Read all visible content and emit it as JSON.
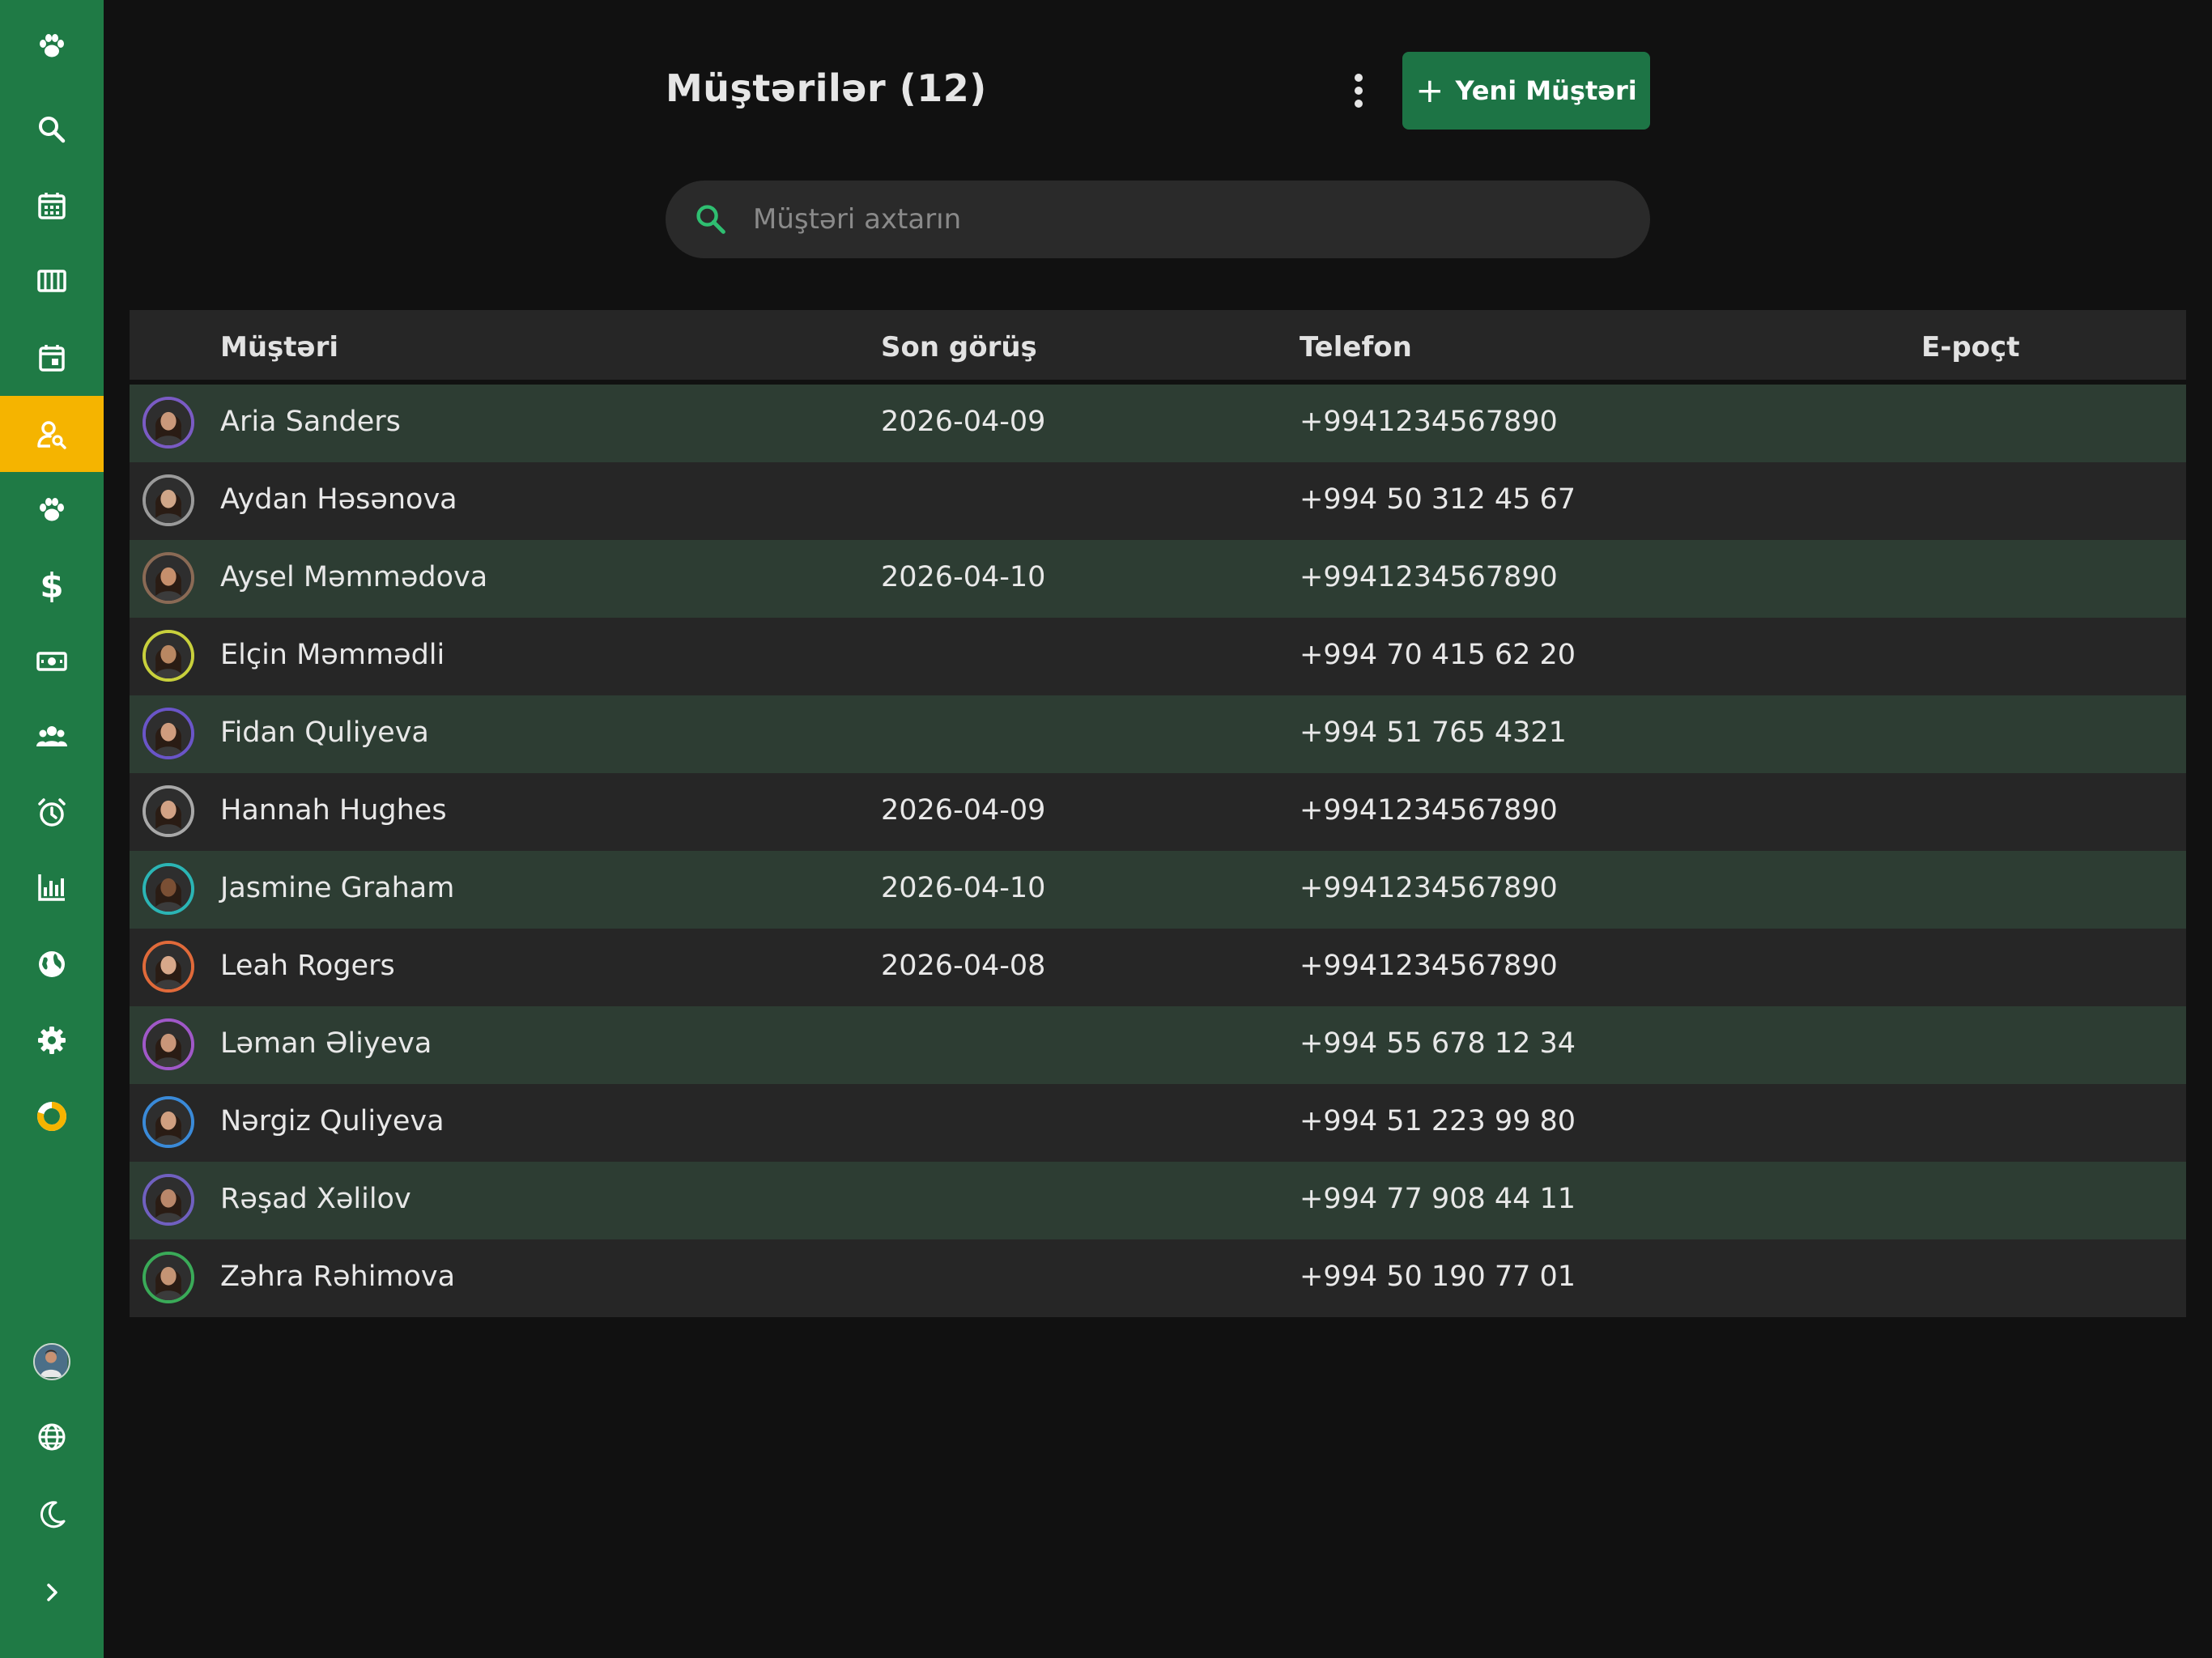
{
  "colors": {
    "sidebar": "#1f7a45",
    "active_nav": "#f5b400",
    "primary_button": "#1d7445",
    "search_icon": "#2fbf71",
    "row_highlight": "#2d3d33",
    "row_alt": "#262626",
    "background": "#111111"
  },
  "sidebar": {
    "items": [
      {
        "icon": "paw-icon"
      },
      {
        "icon": "search-icon"
      },
      {
        "icon": "calendar-icon"
      },
      {
        "icon": "columns-icon"
      },
      {
        "icon": "calendar-day-icon"
      },
      {
        "icon": "customer-search-icon",
        "active": true
      },
      {
        "icon": "paw-icon"
      },
      {
        "icon": "dollar-icon"
      },
      {
        "icon": "cash-icon"
      },
      {
        "icon": "team-icon"
      },
      {
        "icon": "alarm-clock-icon"
      },
      {
        "icon": "bar-chart-icon"
      },
      {
        "icon": "globe-icon"
      },
      {
        "icon": "gear-icon"
      },
      {
        "icon": "progress-ring-icon"
      }
    ],
    "bottom": [
      {
        "icon": "user-avatar"
      },
      {
        "icon": "language-globe-icon"
      },
      {
        "icon": "moon-icon"
      },
      {
        "icon": "chevron-right-icon"
      }
    ]
  },
  "header": {
    "title": "Müştərilər (12)",
    "new_button": "Yeni Müştəri"
  },
  "search": {
    "placeholder": "Müştəri axtarın",
    "value": ""
  },
  "table": {
    "columns": [
      "Müştəri",
      "Son görüş",
      "Telefon",
      "E-poçt"
    ],
    "rows": [
      {
        "name": "Aria Sanders",
        "last_visit": "2026-04-09",
        "phone": "+9941234567890",
        "email": "",
        "avatar_ring": "#7a5bc4",
        "avatar_skin": "#c9987a"
      },
      {
        "name": "Aydan Həsənova",
        "last_visit": "",
        "phone": "+994 50 312 45 67",
        "email": "",
        "avatar_ring": "#9a9a9a",
        "avatar_skin": "#d0a688"
      },
      {
        "name": "Aysel Məmmədova",
        "last_visit": "2026-04-10",
        "phone": "+9941234567890",
        "email": "",
        "avatar_ring": "#8a6a55",
        "avatar_skin": "#c68f6c"
      },
      {
        "name": "Elçin Məmmədli",
        "last_visit": "",
        "phone": "+994 70 415 62 20",
        "email": "",
        "avatar_ring": "#c8d03c",
        "avatar_skin": "#b98762"
      },
      {
        "name": "Fidan Quliyeva",
        "last_visit": "",
        "phone": "+994 51 765 4321",
        "email": "",
        "avatar_ring": "#6a55c8",
        "avatar_skin": "#cf9c7e"
      },
      {
        "name": "Hannah Hughes",
        "last_visit": "2026-04-09",
        "phone": "+9941234567890",
        "email": "",
        "avatar_ring": "#a8a8a8",
        "avatar_skin": "#d2a285"
      },
      {
        "name": "Jasmine Graham",
        "last_visit": "2026-04-10",
        "phone": "+9941234567890",
        "email": "",
        "avatar_ring": "#2bb5b5",
        "avatar_skin": "#7a4f34"
      },
      {
        "name": "Leah Rogers",
        "last_visit": "2026-04-08",
        "phone": "+9941234567890",
        "email": "",
        "avatar_ring": "#e06a3a",
        "avatar_skin": "#d8a88a"
      },
      {
        "name": "Ləman Əliyeva",
        "last_visit": "",
        "phone": "+994 55 678 12 34",
        "email": "",
        "avatar_ring": "#a058c8",
        "avatar_skin": "#c99679"
      },
      {
        "name": "Nərgiz Quliyeva",
        "last_visit": "",
        "phone": "+994 51 223 99 80",
        "email": "",
        "avatar_ring": "#3a8ad8",
        "avatar_skin": "#d09f80"
      },
      {
        "name": "Rəşad Xəlilov",
        "last_visit": "",
        "phone": "+994 77 908 44 11",
        "email": "",
        "avatar_ring": "#7060c0",
        "avatar_skin": "#b9876a"
      },
      {
        "name": "Zəhra Rəhimova",
        "last_visit": "",
        "phone": "+994 50 190 77 01",
        "email": "",
        "avatar_ring": "#3aaa58",
        "avatar_skin": "#c49474"
      }
    ]
  }
}
